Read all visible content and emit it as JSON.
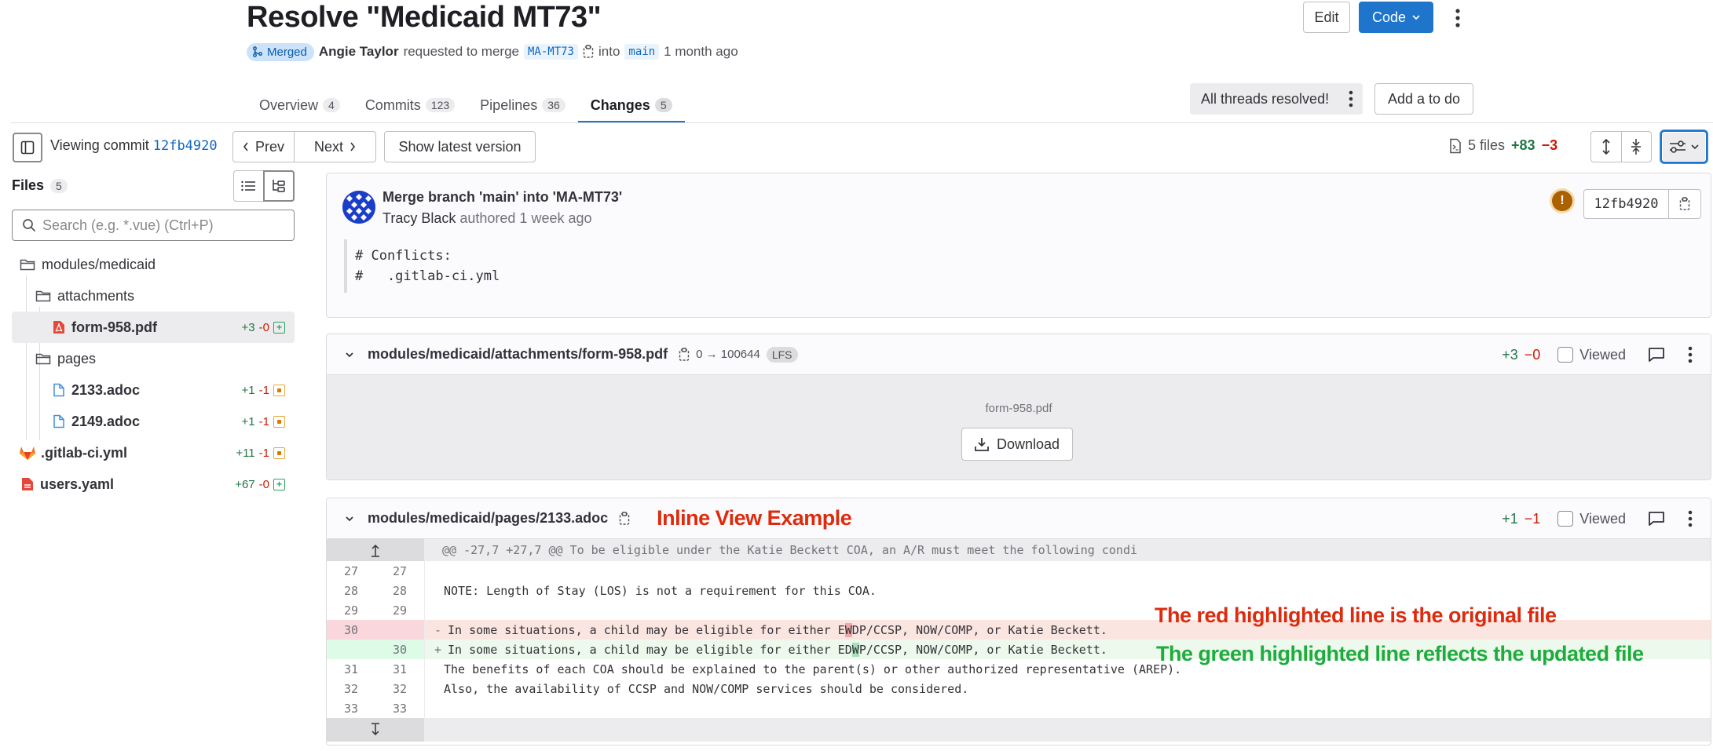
{
  "header": {
    "title": "Resolve \"Medicaid MT73\"",
    "status": "Merged",
    "author": "Angie Taylor",
    "action": "requested to merge",
    "source_branch": "MA-MT73",
    "into": "into",
    "target_branch": "main",
    "time": "1 month ago",
    "edit_label": "Edit",
    "code_label": "Code"
  },
  "tabs": [
    {
      "label": "Overview",
      "count": "4"
    },
    {
      "label": "Commits",
      "count": "123"
    },
    {
      "label": "Pipelines",
      "count": "36"
    },
    {
      "label": "Changes",
      "count": "5",
      "active": true
    }
  ],
  "threads": {
    "label": "All threads resolved!",
    "todo_label": "Add a to do"
  },
  "toolbar": {
    "viewing_label": "Viewing commit",
    "commit_sha": "12fb4920",
    "prev_label": "Prev",
    "next_label": "Next",
    "latest_label": "Show latest version",
    "files_count": "5 files",
    "additions": "+83",
    "deletions": "−3"
  },
  "sidebar": {
    "title": "Files",
    "count": "5",
    "search_placeholder": "Search (e.g. *.vue) (Ctrl+P)",
    "tree": [
      {
        "type": "folder",
        "name": "modules/medicaid",
        "depth": 0
      },
      {
        "type": "folder",
        "name": "attachments",
        "depth": 1
      },
      {
        "type": "file",
        "name": "form-958.pdf",
        "depth": 2,
        "icon": "pdf",
        "add": "+3",
        "del": "-0",
        "status": "added",
        "selected": true
      },
      {
        "type": "folder",
        "name": "pages",
        "depth": 1
      },
      {
        "type": "file",
        "name": "2133.adoc",
        "depth": 2,
        "icon": "doc",
        "add": "+1",
        "del": "-1",
        "status": "modified"
      },
      {
        "type": "file",
        "name": "2149.adoc",
        "depth": 2,
        "icon": "doc",
        "add": "+1",
        "del": "-1",
        "status": "modified"
      },
      {
        "type": "file",
        "name": ".gitlab-ci.yml",
        "depth": 0,
        "icon": "gitlab",
        "add": "+11",
        "del": "-1",
        "status": "modified"
      },
      {
        "type": "file",
        "name": "users.yaml",
        "depth": 0,
        "icon": "yaml",
        "add": "+67",
        "del": "-0",
        "status": "added"
      }
    ]
  },
  "commit": {
    "title": "Merge branch 'main' into 'MA-MT73'",
    "author": "Tracy Black",
    "authored": "authored 1 week ago",
    "description": "# Conflicts:\n#   .gitlab-ci.yml",
    "sha": "12fb4920"
  },
  "files": [
    {
      "path": "modules/medicaid/attachments/form-958.pdf",
      "size_change": "0 → 100644",
      "lfs": "LFS",
      "add": "+3",
      "del": "−0",
      "viewed_label": "Viewed",
      "binary_name": "form-958.pdf",
      "download_label": "Download"
    },
    {
      "path": "modules/medicaid/pages/2133.adoc",
      "annotation": "Inline View Example",
      "add": "+1",
      "del": "−1",
      "viewed_label": "Viewed",
      "hunk": "@@ -27,7 +27,7 @@ To be eligible under the Katie Beckett COA, an A/R must meet the following condi",
      "lines": [
        {
          "old": "27",
          "new": "27",
          "type": "ctx",
          "text": ""
        },
        {
          "old": "28",
          "new": "28",
          "type": "ctx",
          "text": "NOTE: Length of Stay (LOS) is not a requirement for this COA."
        },
        {
          "old": "29",
          "new": "29",
          "type": "ctx",
          "text": ""
        },
        {
          "old": "30",
          "new": "",
          "type": "del",
          "text_before": "In some situations, a child may be eligible for either E",
          "text_hl": "W",
          "text_after": "DP/CCSP, NOW/COMP, or Katie Beckett."
        },
        {
          "old": "",
          "new": "30",
          "type": "add",
          "text_before": "In some situations, a child may be eligible for either ED",
          "text_hl": "W",
          "text_after": "P/CCSP, NOW/COMP, or Katie Beckett."
        },
        {
          "old": "31",
          "new": "31",
          "type": "ctx",
          "text": "The benefits of each COA should be explained to the parent(s) or other authorized representative (AREP)."
        },
        {
          "old": "32",
          "new": "32",
          "type": "ctx",
          "text": "Also, the availability of CCSP and NOW/COMP services should be considered."
        },
        {
          "old": "33",
          "new": "33",
          "type": "ctx",
          "text": ""
        }
      ]
    }
  ],
  "annotations": {
    "red": "The red highlighted line is the original file",
    "green": "The green highlighted line reflects the updated file"
  }
}
